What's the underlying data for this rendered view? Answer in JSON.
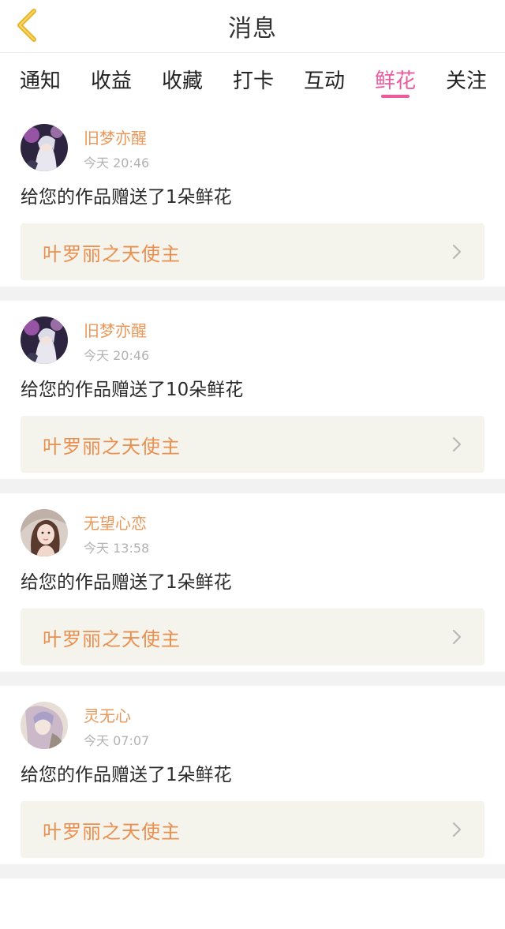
{
  "header": {
    "title": "消息"
  },
  "tabs": [
    {
      "label": "通知",
      "active": false
    },
    {
      "label": "收益",
      "active": false
    },
    {
      "label": "收藏",
      "active": false
    },
    {
      "label": "打卡",
      "active": false
    },
    {
      "label": "互动",
      "active": false
    },
    {
      "label": "鲜花",
      "active": true
    },
    {
      "label": "关注",
      "active": false
    }
  ],
  "items": [
    {
      "username": "旧梦亦醒",
      "time": "今天 20:46",
      "message": "给您的作品赠送了1朵鲜花",
      "work_title": "叶罗丽之天使主",
      "avatar_style": "anime-dark"
    },
    {
      "username": "旧梦亦醒",
      "time": "今天 20:46",
      "message": "给您的作品赠送了10朵鲜花",
      "work_title": "叶罗丽之天使主",
      "avatar_style": "anime-dark"
    },
    {
      "username": "无望心恋",
      "time": "今天 13:58",
      "message": "给您的作品赠送了1朵鲜花",
      "work_title": "叶罗丽之天使主",
      "avatar_style": "photo-girl"
    },
    {
      "username": "灵无心",
      "time": "今天 07:07",
      "message": "给您的作品赠送了1朵鲜花",
      "work_title": "叶罗丽之天使主",
      "avatar_style": "anime-light"
    }
  ],
  "colors": {
    "accent": "#ec5a9b",
    "username": "#e8985a",
    "work_title": "#ea8f50",
    "work_bg": "#f4f4ec",
    "back_icon": "#e7b428"
  }
}
